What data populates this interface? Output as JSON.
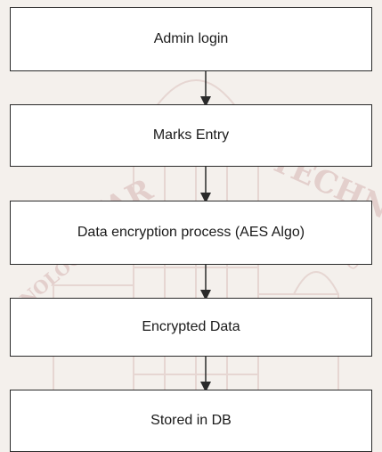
{
  "flowchart": {
    "steps": [
      {
        "label": "Admin login"
      },
      {
        "label": "Marks Entry"
      },
      {
        "label": "Data encryption process (AES Algo)"
      },
      {
        "label": "Encrypted Data"
      },
      {
        "label": "Stored in DB"
      }
    ]
  },
  "watermark": {
    "text_left": "SEKAR",
    "text_right": "TECHNIC",
    "text_lower_left": "NOLOGY",
    "text_lower_right": "ITU"
  },
  "colors": {
    "box_border": "#2a2a2a",
    "box_fill": "#ffffff",
    "arrow": "#2a2a2a",
    "background": "#f4f0ec",
    "watermark": "#e3cfcc"
  }
}
